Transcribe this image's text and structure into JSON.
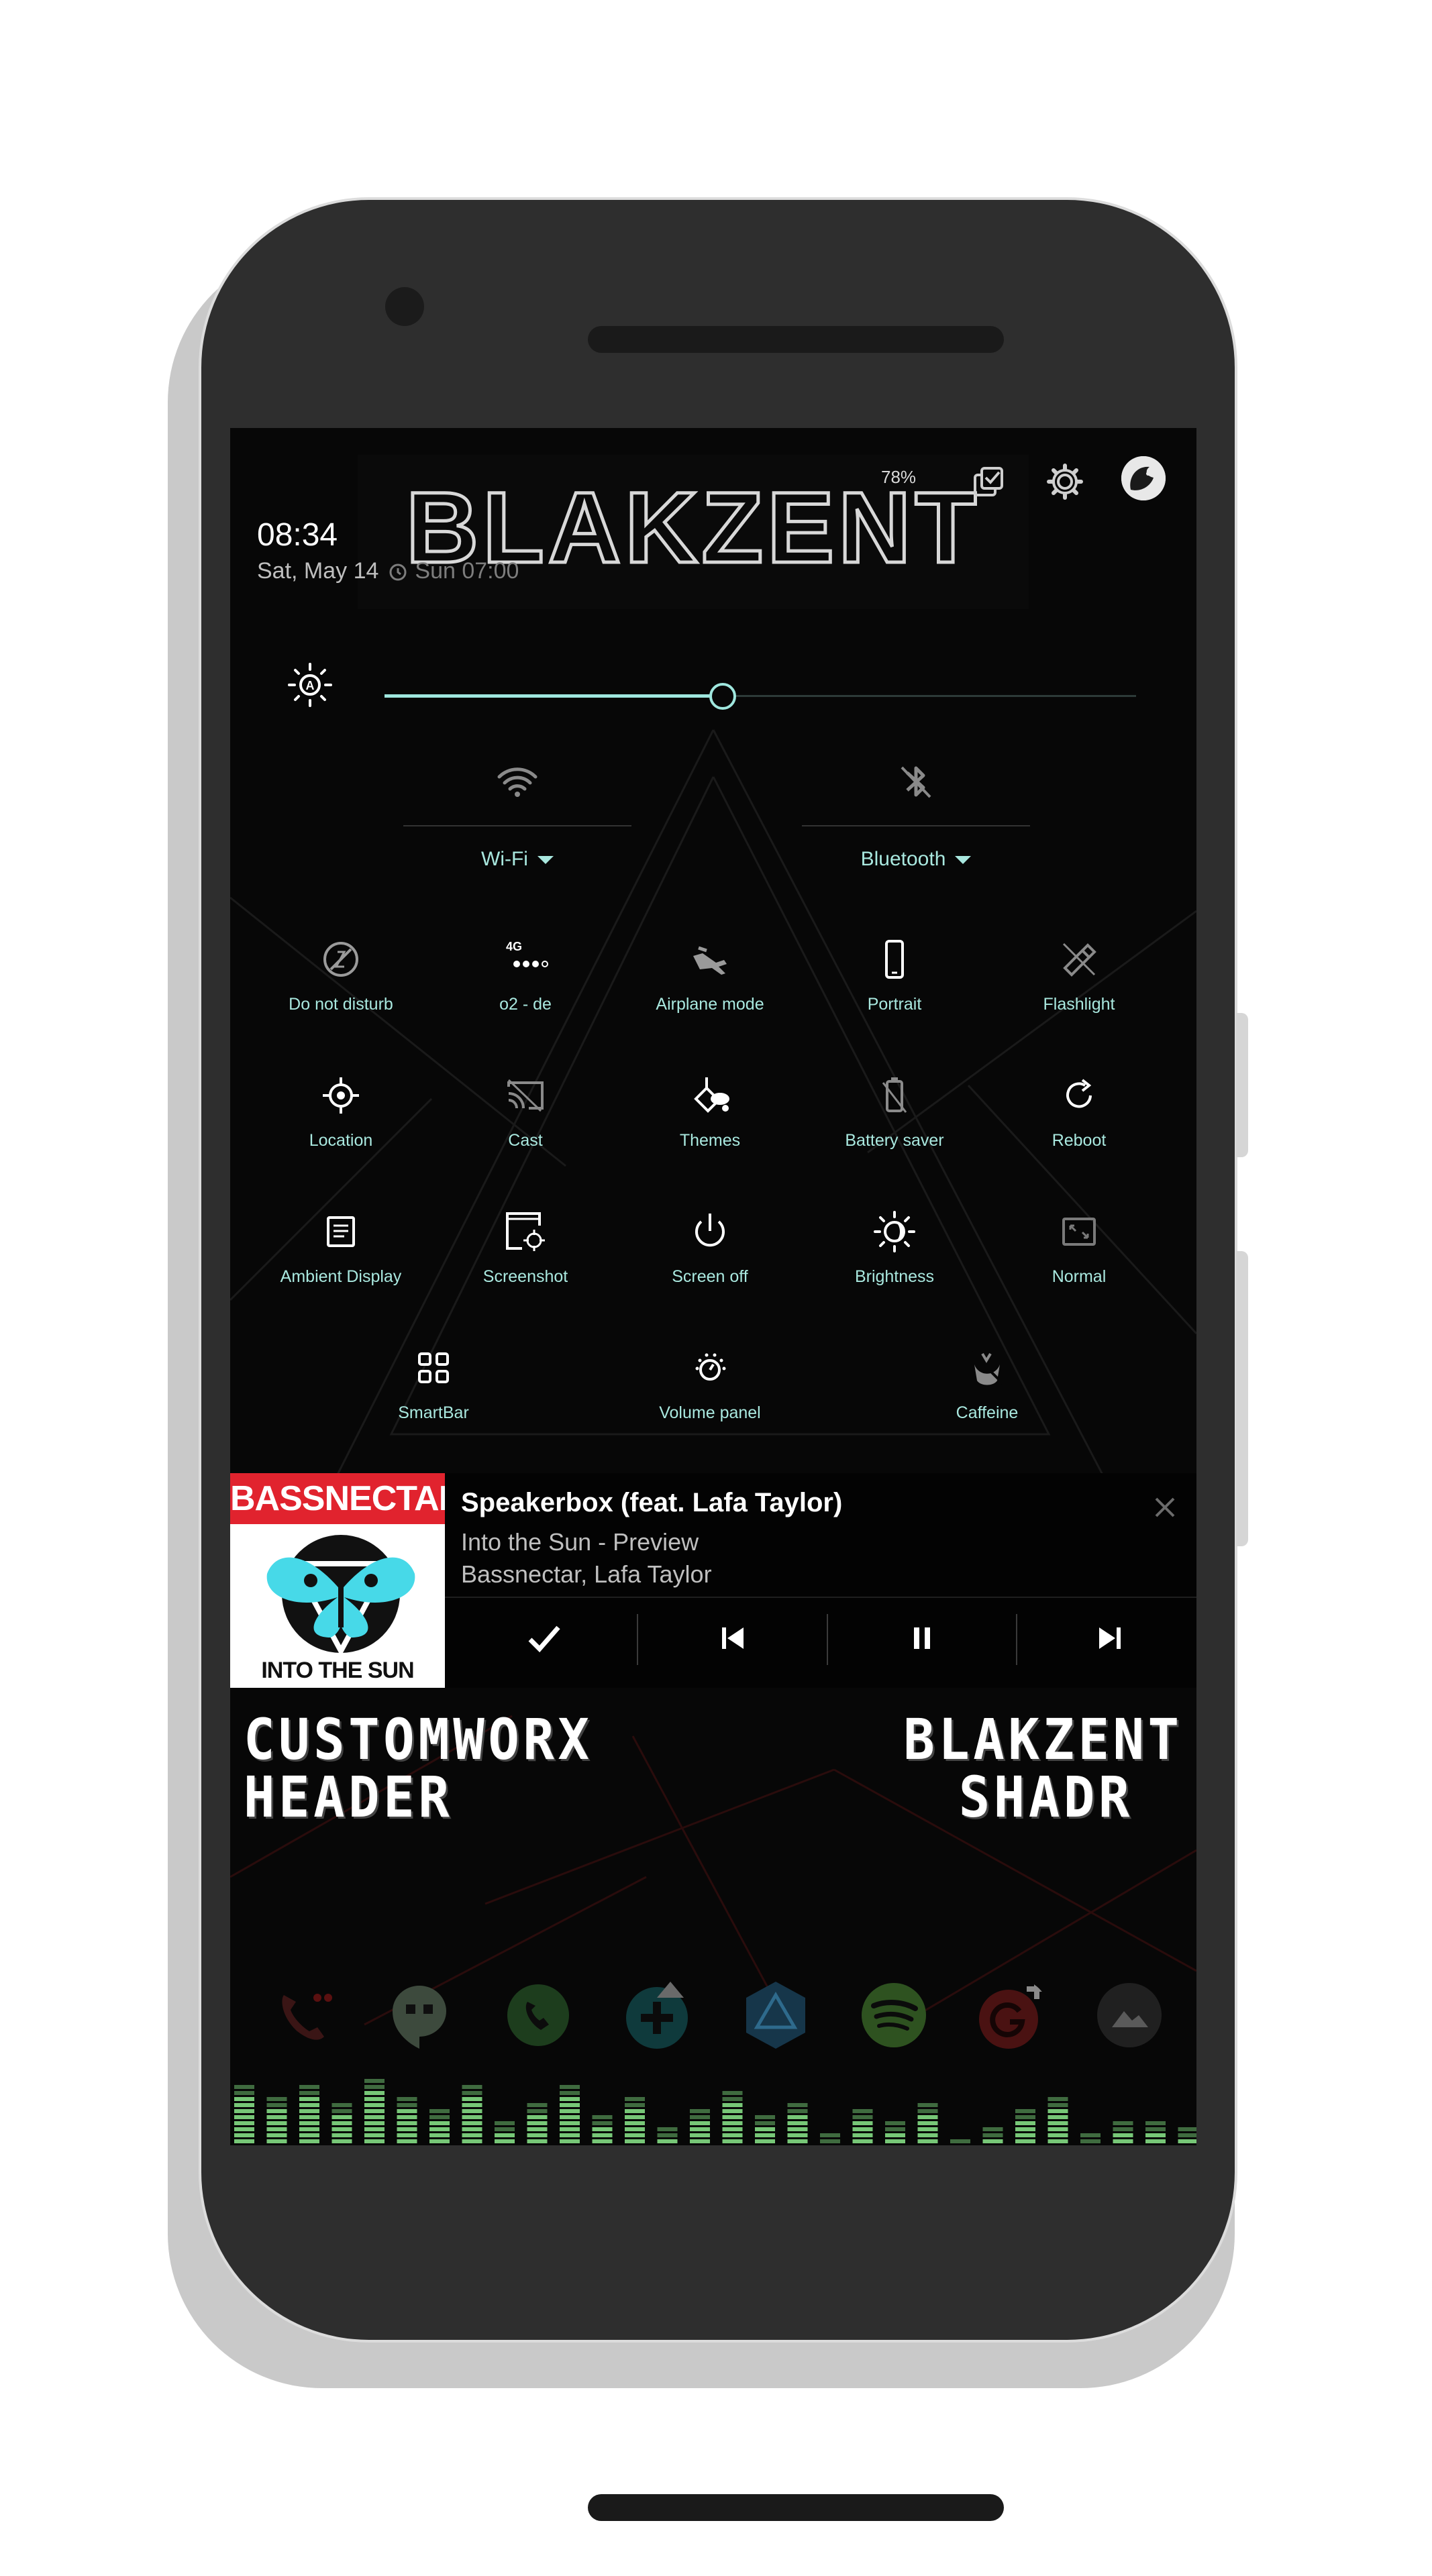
{
  "status": {
    "time": "08:34",
    "date": "Sat, May 14",
    "alarm": "Sun 07:00",
    "battery": "78%"
  },
  "header": {
    "logo_text": "BLAKZENT"
  },
  "brightness": {
    "level_percent": 45
  },
  "big_tiles": [
    {
      "label": "Wi-Fi",
      "icon": "wifi-icon"
    },
    {
      "label": "Bluetooth",
      "icon": "bluetooth-icon"
    }
  ],
  "tiles": {
    "row1": [
      {
        "label": "Do not disturb",
        "icon": "do-not-disturb-icon"
      },
      {
        "label": "o2 - de",
        "icon": "signal-icon",
        "badge": "4G"
      },
      {
        "label": "Airplane mode",
        "icon": "airplane-icon"
      },
      {
        "label": "Portrait",
        "icon": "portrait-icon"
      },
      {
        "label": "Flashlight",
        "icon": "flashlight-icon"
      }
    ],
    "row2": [
      {
        "label": "Location",
        "icon": "location-icon"
      },
      {
        "label": "Cast",
        "icon": "cast-icon"
      },
      {
        "label": "Themes",
        "icon": "themes-icon"
      },
      {
        "label": "Battery saver",
        "icon": "battery-saver-icon"
      },
      {
        "label": "Reboot",
        "icon": "reboot-icon"
      }
    ],
    "row3": [
      {
        "label": "Ambient Display",
        "icon": "ambient-display-icon"
      },
      {
        "label": "Screenshot",
        "icon": "screenshot-icon"
      },
      {
        "label": "Screen off",
        "icon": "power-icon"
      },
      {
        "label": "Brightness",
        "icon": "brightness-icon"
      },
      {
        "label": "Normal",
        "icon": "normal-icon"
      }
    ],
    "row4": [
      {
        "label": "SmartBar",
        "icon": "smartbar-icon"
      },
      {
        "label": "Volume panel",
        "icon": "volume-panel-icon"
      },
      {
        "label": "Caffeine",
        "icon": "caffeine-icon"
      }
    ]
  },
  "media": {
    "art_top": "BASSNECTAR",
    "art_bottom": "INTO THE SUN",
    "title": "Speakerbox (feat. Lafa Taylor)",
    "album": "Into the Sun - Preview",
    "artist": "Bassnectar, Lafa Taylor"
  },
  "wallpaper": {
    "left_line1": "CUSTOMWORX",
    "left_line2": "HEADER",
    "right_line1": "BLAKZENT",
    "right_line2": "SHADR"
  },
  "dock": [
    "phone-icon",
    "hangouts-icon",
    "whatsapp-icon",
    "add-app-icon",
    "ingress-icon",
    "spotify-icon",
    "google-plus-icon",
    "gallery-icon"
  ],
  "colors": {
    "accent": "#a9e8df",
    "slider": "#9fe7de",
    "screen_bg": "#070707",
    "bezel": "#2e2e2e"
  }
}
